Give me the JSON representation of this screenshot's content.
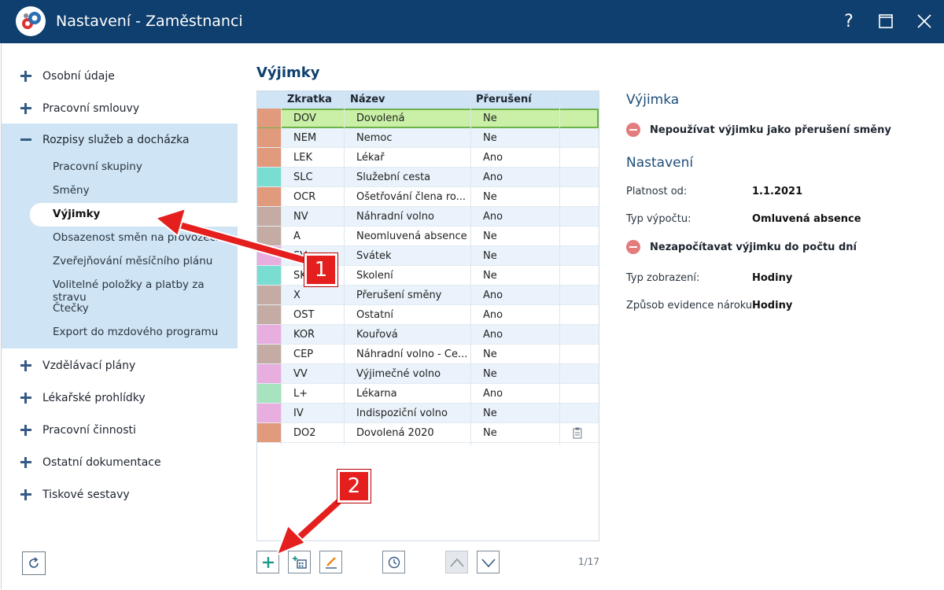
{
  "window": {
    "title": "Nastavení - Zaměstnanci",
    "help_glyph": "?"
  },
  "sidebar": {
    "items_top": [
      {
        "label": "Osobní údaje"
      },
      {
        "label": "Pracovní smlouvy"
      },
      {
        "label": "Rozpisy služeb a docházka"
      }
    ],
    "subitems": [
      {
        "label": "Pracovní skupiny"
      },
      {
        "label": "Směny"
      },
      {
        "label": "Výjimky",
        "active": true
      },
      {
        "label": "Obsazenost směn na provozech"
      },
      {
        "label": "Zveřejňování měsíčního plánu"
      },
      {
        "label": "Volitelné položky a platby za stravu"
      },
      {
        "label": "Čtečky"
      },
      {
        "label": "Export do mzdového programu"
      }
    ],
    "items_bottom": [
      {
        "label": "Vzdělávací plány"
      },
      {
        "label": "Lékařské prohlídky"
      },
      {
        "label": "Pracovní činnosti"
      },
      {
        "label": "Ostatní dokumentace"
      },
      {
        "label": "Tiskové sestavy"
      }
    ]
  },
  "main": {
    "title": "Výjimky",
    "columns": [
      "Zkratka",
      "Název",
      "Přerušení"
    ],
    "rows": [
      {
        "color": "#e19a7b",
        "code": "DOV",
        "name": "Dovolená",
        "break": "Ne",
        "selected": true
      },
      {
        "color": "#e19a7b",
        "code": "NEM",
        "name": "Nemoc",
        "break": "Ne"
      },
      {
        "color": "#e19a7b",
        "code": "LEK",
        "name": "Lékař",
        "break": "Ano"
      },
      {
        "color": "#79ddd2",
        "code": "SLC",
        "name": "Služební cesta",
        "break": "Ano"
      },
      {
        "color": "#e19a7b",
        "code": "OČR",
        "name": "Ošetřování člena ro...",
        "break": "Ne"
      },
      {
        "color": "#c4aca4",
        "code": "NV",
        "name": "Náhradní volno",
        "break": "Ano"
      },
      {
        "color": "#c4aca4",
        "code": "A",
        "name": "Neomluvená absence",
        "break": "Ne"
      },
      {
        "color": "#e8aee0",
        "code": "SV",
        "name": "Svátek",
        "break": "Ne"
      },
      {
        "color": "#79ddd2",
        "code": "SK",
        "name": "Školení",
        "break": "Ne"
      },
      {
        "color": "#c4aca4",
        "code": "X",
        "name": "Přerušení směny",
        "break": "Ano"
      },
      {
        "color": "#c4aca4",
        "code": "OST",
        "name": "Ostatní",
        "break": "Ano"
      },
      {
        "color": "#e8aee0",
        "code": "KOŘ",
        "name": "Kouřová",
        "break": "Ano"
      },
      {
        "color": "#c4aca4",
        "code": "ČEP",
        "name": "Náhradní volno - Če...",
        "break": "Ne"
      },
      {
        "color": "#e8aee0",
        "code": "VV",
        "name": "Výjimečné volno",
        "break": "Ne"
      },
      {
        "color": "#a6e3be",
        "code": "L+",
        "name": "Lékarna",
        "break": "Ano"
      },
      {
        "color": "#e8aee0",
        "code": "IV",
        "name": "Indispoziční volno",
        "break": "Ne"
      },
      {
        "color": "#e19a7b",
        "code": "DO2",
        "name": "Dovolená 2020",
        "break": "Ne",
        "icon": "clipboard-icon"
      }
    ],
    "pager": "1/17"
  },
  "detail": {
    "heading1": "Výjimka",
    "flag1": "Nepoužívat výjimku jako přerušení směny",
    "heading2": "Nastavení",
    "valid_from_label": "Platnost od:",
    "valid_from_value": "1.1.2021",
    "calc_type_label": "Typ výpočtu:",
    "calc_type_value": "Omluvená absence",
    "flag2": "Nezapočítavat výjimku do počtu dní",
    "display_type_label": "Typ zobrazení:",
    "display_type_value": "Hodiny",
    "claim_label": "Způsob evidence nároku:",
    "claim_value": "Hodiny"
  },
  "callouts": {
    "one": "1",
    "two": "2"
  },
  "colors": {
    "titlebar": "#0e3f6e",
    "accent": "#1e4d7a",
    "callout": "#e51e1e",
    "selected_row": "#c9f0a6"
  }
}
